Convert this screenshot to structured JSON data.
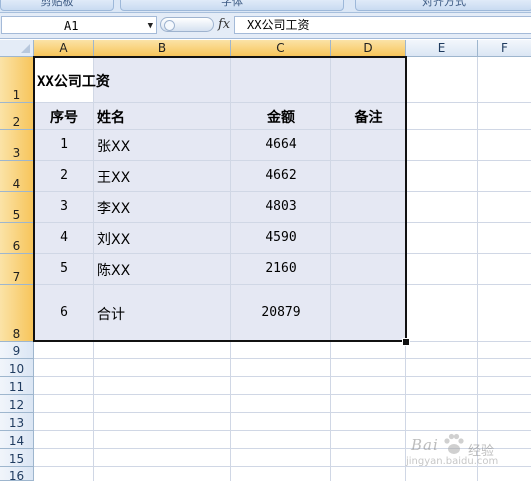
{
  "ribbon": {
    "groups": [
      "剪贴板",
      "字体",
      "对齐方式"
    ]
  },
  "formula_bar": {
    "name_box": "A1",
    "fx_label": "fx",
    "formula": "XX公司工资"
  },
  "columns": [
    "A",
    "B",
    "C",
    "D",
    "E",
    "F"
  ],
  "rows": [
    "1",
    "2",
    "3",
    "4",
    "5",
    "6",
    "7",
    "8",
    "9",
    "10",
    "11",
    "12",
    "13",
    "14",
    "15",
    "16"
  ],
  "sheet": {
    "title": "XX公司工资",
    "headers": {
      "seq": "序号",
      "name": "姓名",
      "amount": "金额",
      "note": "备注"
    },
    "records": [
      {
        "seq": "1",
        "name": "张XX",
        "amount": "4664"
      },
      {
        "seq": "2",
        "name": "王XX",
        "amount": "4662"
      },
      {
        "seq": "3",
        "name": "李XX",
        "amount": "4803"
      },
      {
        "seq": "4",
        "name": "刘XX",
        "amount": "4590"
      },
      {
        "seq": "5",
        "name": "陈XX",
        "amount": "2160"
      },
      {
        "seq": "6",
        "name": "合计",
        "amount": "20879"
      }
    ]
  },
  "watermark": {
    "brand": "Bai",
    "suffix": "经验",
    "url": "jingyan.baidu.com"
  }
}
